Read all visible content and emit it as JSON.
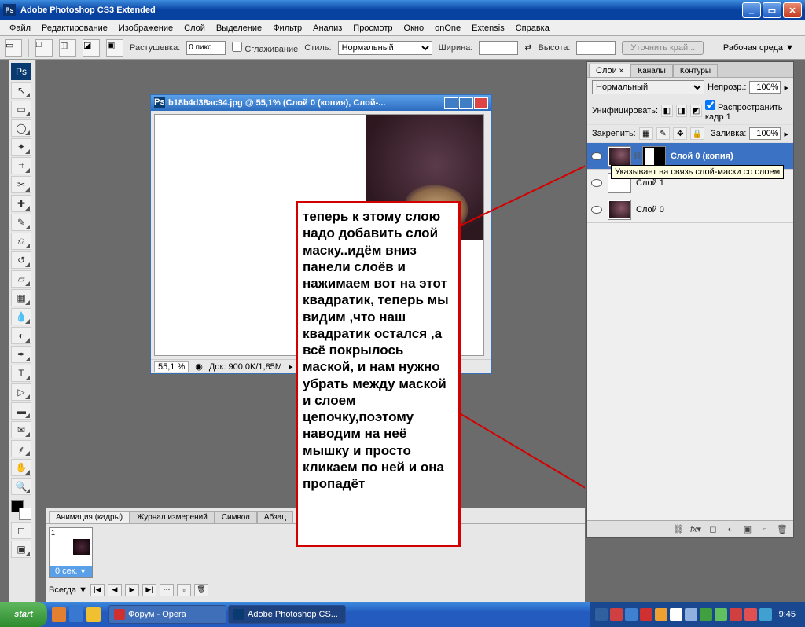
{
  "titlebar": {
    "title": "Adobe Photoshop CS3 Extended"
  },
  "menu": [
    "Файл",
    "Редактирование",
    "Изображение",
    "Слой",
    "Выделение",
    "Фильтр",
    "Анализ",
    "Просмотр",
    "Окно",
    "onOne",
    "Extensis",
    "Справка"
  ],
  "options": {
    "feather_label": "Растушевка:",
    "feather_value": "0 пикс",
    "antialias": "Сглаживание",
    "style_label": "Стиль:",
    "style_value": "Нормальный",
    "width_label": "Ширина:",
    "height_label": "Высота:",
    "refine": "Уточнить край...",
    "workspace": "Рабочая среда ▼"
  },
  "document": {
    "title": "b18b4d38ac94.jpg @ 55,1% (Слой 0 (копия), Слой-...",
    "zoom": "55,1 %",
    "docinfo": "Док: 900,0K/1,85M"
  },
  "annotation_text": "теперь к этому слою надо добавить слой маску..идём вниз панели слоёв и нажимаем вот на этот квадратик, теперь мы видим ,что наш квадратик остался ,а всё покрылось маской, и нам нужно убрать между маской и слоем цепочку,поэтому наводим на неё мышку и просто кликаем по ней и она пропадёт",
  "animation": {
    "tabs": [
      "Анимация (кадры)",
      "Журнал измерений",
      "Символ",
      "Абзац"
    ],
    "frame_num": "1",
    "frame_time": "0 сек.",
    "forever": "Всегда"
  },
  "layers_panel": {
    "tabs": [
      "Слои",
      "Каналы",
      "Контуры"
    ],
    "blend_mode": "Нормальный",
    "opacity_label": "Непрозр.:",
    "opacity_value": "100%",
    "unify_label": "Унифицировать:",
    "propagate": "Распространить кадр 1",
    "lock_label": "Закрепить:",
    "fill_label": "Заливка:",
    "fill_value": "100%",
    "layers": [
      {
        "name": "Слой 0 (копия)",
        "selected": true,
        "has_mask": true
      },
      {
        "name": "Слой 1",
        "selected": false,
        "has_mask": false
      },
      {
        "name": "Слой 0",
        "selected": false,
        "has_mask": false
      }
    ],
    "tooltip": "Указывает на связь слой-маски со слоем"
  },
  "taskbar": {
    "tasks": [
      {
        "label": "Форум - Opera"
      },
      {
        "label": "Adobe Photoshop CS..."
      }
    ],
    "clock": "9:45"
  }
}
